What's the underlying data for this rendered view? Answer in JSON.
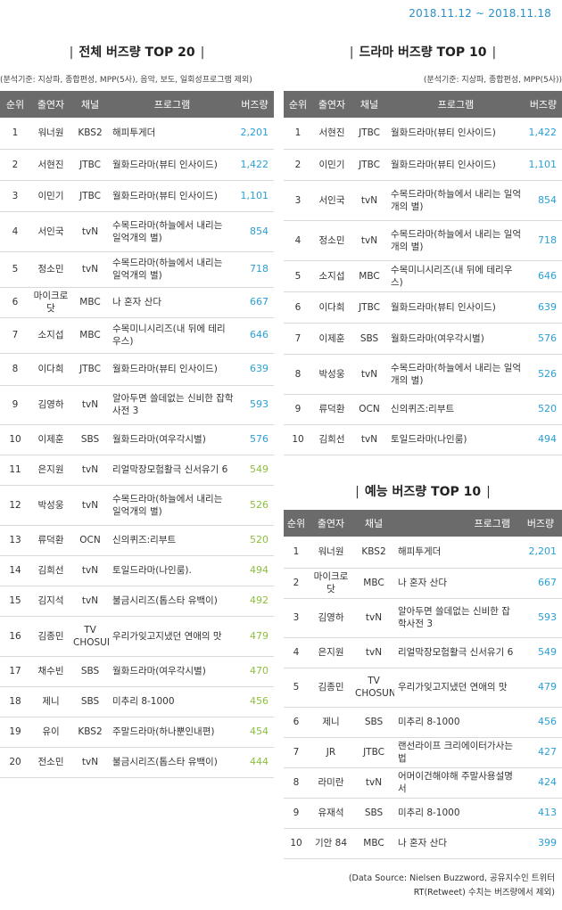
{
  "date_range": "2018.11.12 ~ 2018.11.18",
  "headers": [
    "순위",
    "출연자",
    "채널",
    "프로그램",
    "버즈량"
  ],
  "overall": {
    "title": "전체 버즈량 TOP 20",
    "basis": "(분석기준: 지상파, 종합편성, MPP(5사), 음악, 보도, 일회성프로그램 제외)",
    "rows": [
      {
        "rank": "1",
        "cast": "워너원",
        "channel": "KBS2",
        "program": "해피투게더",
        "buzz": "2,201",
        "color": "blue"
      },
      {
        "rank": "2",
        "cast": "서현진",
        "channel": "JTBC",
        "program": "월화드라마(뷰티 인사이드)",
        "buzz": "1,422",
        "color": "blue"
      },
      {
        "rank": "3",
        "cast": "이민기",
        "channel": "JTBC",
        "program": "월화드라마(뷰티 인사이드)",
        "buzz": "1,101",
        "color": "blue"
      },
      {
        "rank": "4",
        "cast": "서인국",
        "channel": "tvN",
        "program": "수목드라마(하늘에서 내리는 일억개의 별)",
        "buzz": "854",
        "color": "blue"
      },
      {
        "rank": "5",
        "cast": "정소민",
        "channel": "tvN",
        "program": "수목드라마(하늘에서 내리는 일억개의 별)",
        "buzz": "718",
        "color": "blue"
      },
      {
        "rank": "6",
        "cast": "마이크로닷",
        "channel": "MBC",
        "program": "나 혼자 산다",
        "buzz": "667",
        "color": "blue"
      },
      {
        "rank": "7",
        "cast": "소지섭",
        "channel": "MBC",
        "program": "수목미니시리즈(내 뒤에 테리우스)",
        "buzz": "646",
        "color": "blue"
      },
      {
        "rank": "8",
        "cast": "이다희",
        "channel": "JTBC",
        "program": "월화드라마(뷰티 인사이드)",
        "buzz": "639",
        "color": "blue"
      },
      {
        "rank": "9",
        "cast": "김영하",
        "channel": "tvN",
        "program": "알아두면 쓸데없는 신비한 잡학사전 3",
        "buzz": "593",
        "color": "blue"
      },
      {
        "rank": "10",
        "cast": "이제훈",
        "channel": "SBS",
        "program": "월화드라마(여우각시별)",
        "buzz": "576",
        "color": "blue"
      },
      {
        "rank": "11",
        "cast": "은지원",
        "channel": "tvN",
        "program": "리얼막장모험활극 신서유기 6",
        "buzz": "549",
        "color": "green"
      },
      {
        "rank": "12",
        "cast": "박성웅",
        "channel": "tvN",
        "program": "수목드라마(하늘에서 내리는 일억개의 별)",
        "buzz": "526",
        "color": "green"
      },
      {
        "rank": "13",
        "cast": "류덕환",
        "channel": "OCN",
        "program": "신의퀴즈:리부트",
        "buzz": "520",
        "color": "green"
      },
      {
        "rank": "14",
        "cast": "김희선",
        "channel": "tvN",
        "program": "토일드라마(나인룸).",
        "buzz": "494",
        "color": "green"
      },
      {
        "rank": "15",
        "cast": "김지석",
        "channel": "tvN",
        "program": "불금시리즈(톱스타 유백이)",
        "buzz": "492",
        "color": "green"
      },
      {
        "rank": "16",
        "cast": "김종민",
        "channel": "TV CHOSUN",
        "program": "우리가잊고지냈던 연애의 맛",
        "buzz": "479",
        "color": "green"
      },
      {
        "rank": "17",
        "cast": "채수빈",
        "channel": "SBS",
        "program": "월화드라마(여우각시별)",
        "buzz": "470",
        "color": "green"
      },
      {
        "rank": "18",
        "cast": "제니",
        "channel": "SBS",
        "program": "미추리 8-1000",
        "buzz": "456",
        "color": "green"
      },
      {
        "rank": "19",
        "cast": "유이",
        "channel": "KBS2",
        "program": "주말드라마(하나뿐인내편)",
        "buzz": "454",
        "color": "green"
      },
      {
        "rank": "20",
        "cast": "전소민",
        "channel": "tvN",
        "program": "불금시리즈(톱스타 유백이)",
        "buzz": "444",
        "color": "green"
      }
    ]
  },
  "drama": {
    "title": "드라마 버즈량 TOP 10",
    "basis": "(분석기준: 지상파, 종합편성, MPP(5사))",
    "rows": [
      {
        "rank": "1",
        "cast": "서현진",
        "channel": "JTBC",
        "program": "월화드라마(뷰티 인사이드)",
        "buzz": "1,422",
        "color": "blue"
      },
      {
        "rank": "2",
        "cast": "이민기",
        "channel": "JTBC",
        "program": "월화드라마(뷰티 인사이드)",
        "buzz": "1,101",
        "color": "blue"
      },
      {
        "rank": "3",
        "cast": "서인국",
        "channel": "tvN",
        "program": "수목드라마(하늘에서 내리는 일억개의 별)",
        "buzz": "854",
        "color": "blue"
      },
      {
        "rank": "4",
        "cast": "정소민",
        "channel": "tvN",
        "program": "수목드라마(하늘에서 내리는 일억개의 별)",
        "buzz": "718",
        "color": "blue"
      },
      {
        "rank": "5",
        "cast": "소지섭",
        "channel": "MBC",
        "program": "수목미니시리즈(내 뒤에 테리우스)",
        "buzz": "646",
        "color": "blue"
      },
      {
        "rank": "6",
        "cast": "이다희",
        "channel": "JTBC",
        "program": "월화드라마(뷰티 인사이드)",
        "buzz": "639",
        "color": "blue"
      },
      {
        "rank": "7",
        "cast": "이제훈",
        "channel": "SBS",
        "program": "월화드라마(여우각시별)",
        "buzz": "576",
        "color": "blue"
      },
      {
        "rank": "8",
        "cast": "박성웅",
        "channel": "tvN",
        "program": "수목드라마(하늘에서 내리는 일억개의 별)",
        "buzz": "526",
        "color": "blue"
      },
      {
        "rank": "9",
        "cast": "류덕환",
        "channel": "OCN",
        "program": "신의퀴즈:리부트",
        "buzz": "520",
        "color": "blue"
      },
      {
        "rank": "10",
        "cast": "김희선",
        "channel": "tvN",
        "program": "토일드라마(나인룸)",
        "buzz": "494",
        "color": "blue"
      }
    ]
  },
  "variety": {
    "title": "예능 버즈량 TOP 10",
    "rows": [
      {
        "rank": "1",
        "cast": "워너원",
        "channel": "KBS2",
        "program": "해피투게더",
        "buzz": "2,201",
        "color": "blue"
      },
      {
        "rank": "2",
        "cast": "마이크로닷",
        "channel": "MBC",
        "program": "나 혼자 산다",
        "buzz": "667",
        "color": "blue"
      },
      {
        "rank": "3",
        "cast": "김영하",
        "channel": "tvN",
        "program": "알아두면 쓸데없는 신비한 잡학사전 3",
        "buzz": "593",
        "color": "blue"
      },
      {
        "rank": "4",
        "cast": "은지원",
        "channel": "tvN",
        "program": "리얼막장모험활극 신서유기 6",
        "buzz": "549",
        "color": "blue"
      },
      {
        "rank": "5",
        "cast": "김종민",
        "channel": "TV CHOSUN",
        "program": "우리가잊고지냈던 연애의 맛",
        "buzz": "479",
        "color": "blue"
      },
      {
        "rank": "6",
        "cast": "제니",
        "channel": "SBS",
        "program": "미추리 8-1000",
        "buzz": "456",
        "color": "blue"
      },
      {
        "rank": "7",
        "cast": "JR",
        "channel": "JTBC",
        "program": "랜선라이프 크리에이터가사는법",
        "buzz": "427",
        "color": "blue"
      },
      {
        "rank": "8",
        "cast": "라미란",
        "channel": "tvN",
        "program": "어머이건해야해 주말사용설명서",
        "buzz": "424",
        "color": "blue"
      },
      {
        "rank": "9",
        "cast": "유재석",
        "channel": "SBS",
        "program": "미추리 8-1000",
        "buzz": "413",
        "color": "blue"
      },
      {
        "rank": "10",
        "cast": "기안 84",
        "channel": "MBC",
        "program": "나 혼자 산다",
        "buzz": "399",
        "color": "blue"
      }
    ]
  },
  "source_note": [
    "(Data Source: Nielsen Buzzword, 공유지수인 트위터",
    "RT(Retweet) 수치는 버즈량에서 제외)"
  ]
}
